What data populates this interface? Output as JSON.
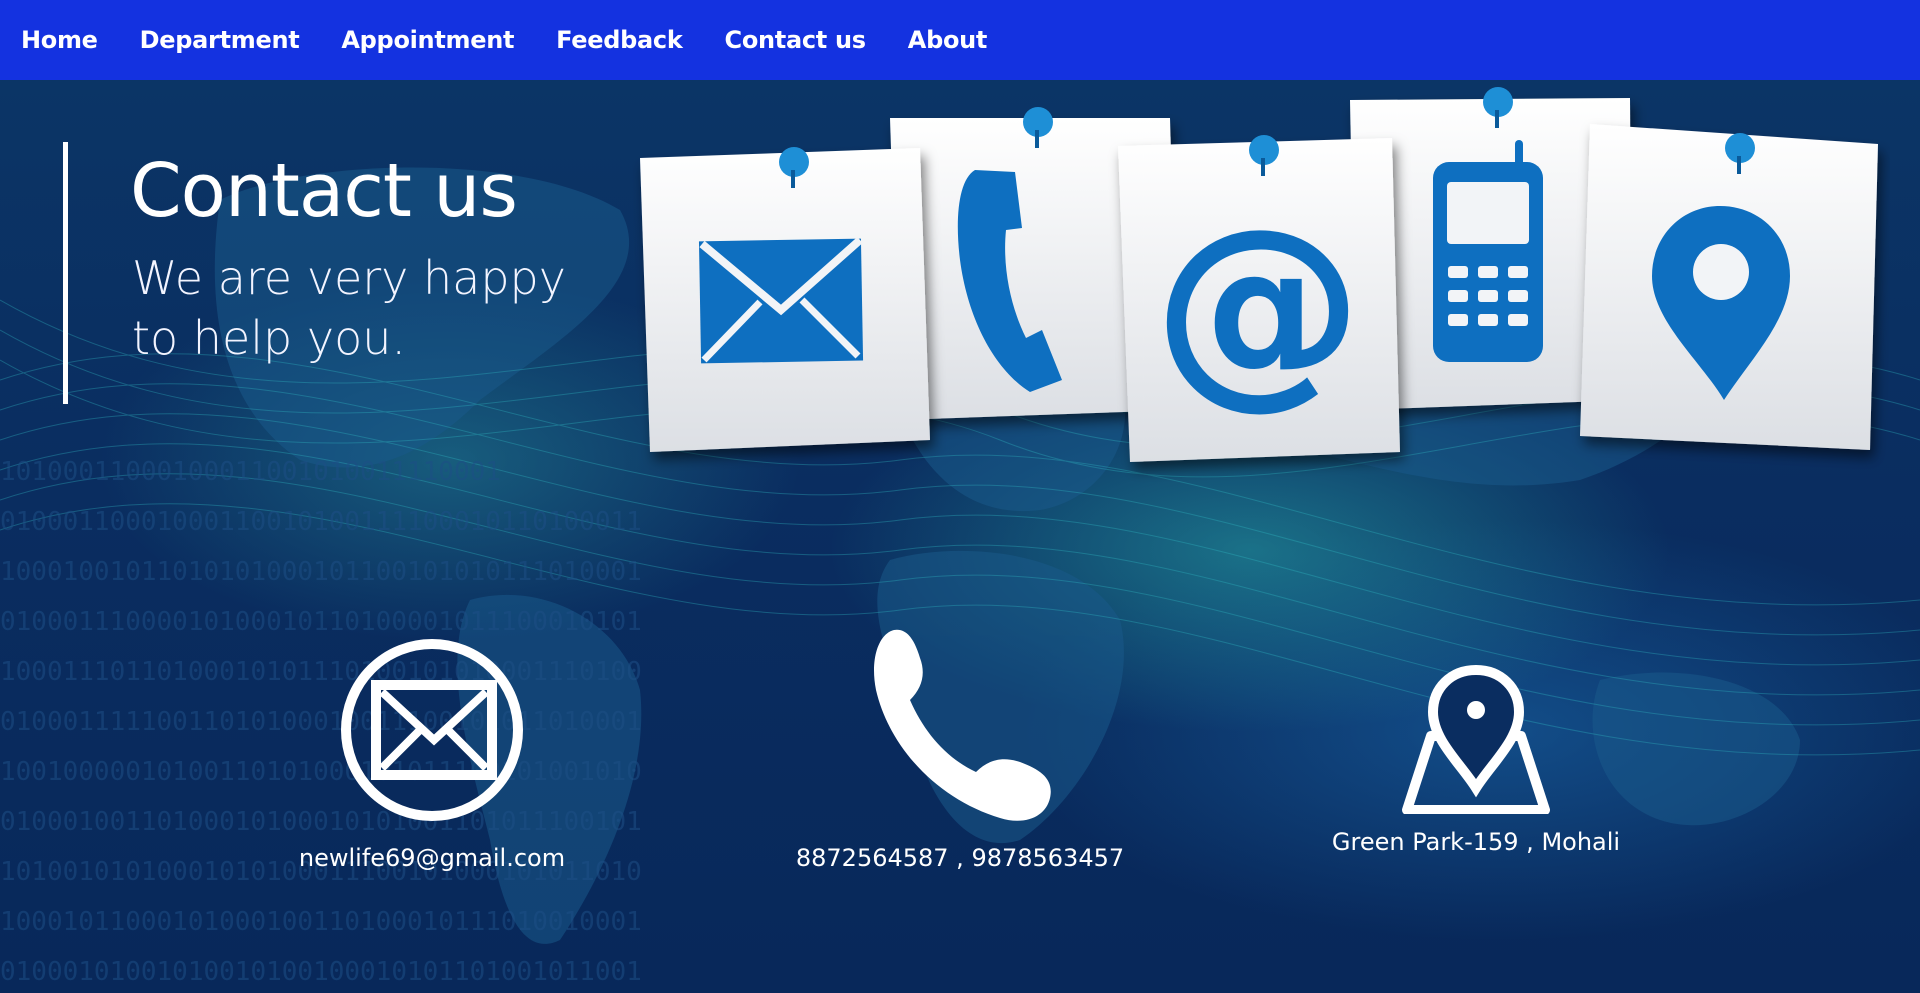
{
  "nav": {
    "items": [
      {
        "label": "Home"
      },
      {
        "label": "Department"
      },
      {
        "label": "Appointment"
      },
      {
        "label": "Feedback"
      },
      {
        "label": "Contact us"
      },
      {
        "label": "About"
      }
    ]
  },
  "hero": {
    "title": "Contact us",
    "subtitle_line1": "We are very happy",
    "subtitle_line2": "to help you."
  },
  "notes_icons": [
    "envelope-icon",
    "phone-handset-icon",
    "at-sign-icon",
    "mobile-phone-icon",
    "location-pin-icon"
  ],
  "contacts": {
    "email": {
      "icon": "envelope-circle-icon",
      "text": "newlife69@gmail.com"
    },
    "phone": {
      "icon": "phone-icon",
      "text": "8872564587 , 9878563457"
    },
    "address": {
      "icon": "map-pin-icon",
      "text": "Green Park-159 , Mohali"
    }
  },
  "colors": {
    "nav_bg": "#1432e0",
    "bg": "#0a2b5c",
    "icon_blue": "#0e6fc0"
  }
}
